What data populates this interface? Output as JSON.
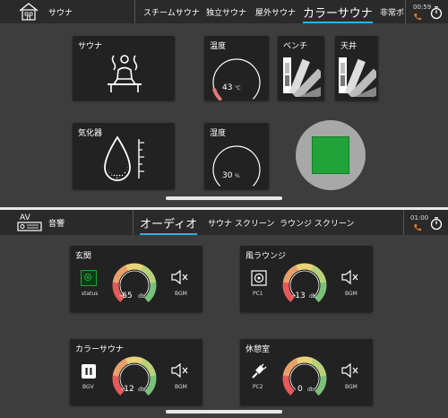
{
  "sauna_screen": {
    "section_label": "サウナ",
    "tabs": [
      {
        "label": "スチームサウナ"
      },
      {
        "label": "独立サウナ"
      },
      {
        "label": "屋外サウナ"
      },
      {
        "label": "カラーサウナ"
      },
      {
        "label": "非常ボ"
      }
    ],
    "active_tab": "カラーサウナ",
    "clock": "00:59",
    "cards": {
      "sauna": {
        "title": "サウナ"
      },
      "temperature": {
        "title": "温度",
        "value": "43",
        "unit": "℃",
        "level": 0.1
      },
      "bench": {
        "title": "ベンチ"
      },
      "ceiling": {
        "title": "天井"
      },
      "vaporizer": {
        "title": "気化器"
      },
      "humidity": {
        "title": "湿度",
        "value": "30",
        "unit": "%",
        "level": 0.3
      }
    },
    "color_swatch": "#22a33a"
  },
  "av_screen": {
    "section_label": "音響",
    "logo_text": "AV",
    "tabs": [
      {
        "label": "オーディオ"
      },
      {
        "label": "サウナ スクリーン"
      },
      {
        "label": "ラウンジ スクリーン"
      }
    ],
    "active_tab": "オーディオ",
    "clock": "01:00",
    "zones": [
      {
        "title": "玄関",
        "source_label": "status",
        "volume": "-65",
        "unit": "db",
        "bgm_label": "BGM"
      },
      {
        "title": "風ラウンジ",
        "source_label": "PC1",
        "volume": "-13",
        "unit": "db",
        "bgm_label": "BGM"
      },
      {
        "title": "カラーサウナ",
        "source_label": "BGV",
        "volume": "-12",
        "unit": "db",
        "bgm_label": "BGM"
      },
      {
        "title": "休憩室",
        "source_label": "PC2",
        "volume": "0",
        "unit": "db",
        "bgm_label": "BGM"
      }
    ]
  }
}
